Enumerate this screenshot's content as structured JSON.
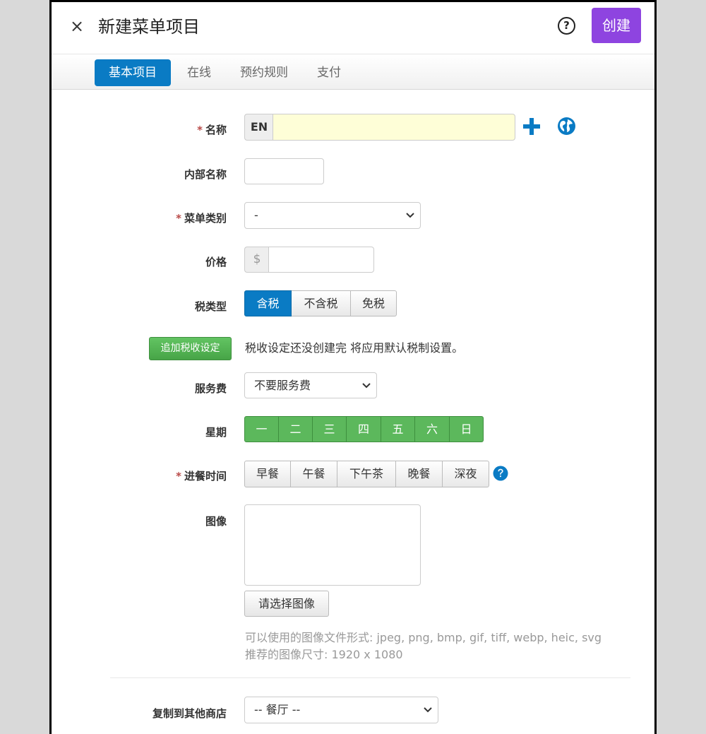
{
  "header": {
    "close_glyph": "×",
    "title": "新建菜单项目",
    "help_glyph": "?",
    "create_label": "创建"
  },
  "tabs": [
    {
      "label": "基本项目",
      "active": true
    },
    {
      "label": "在线",
      "active": false
    },
    {
      "label": "预约规则",
      "active": false
    },
    {
      "label": "支付",
      "active": false
    }
  ],
  "form": {
    "name": {
      "required": "*",
      "label": "名称",
      "lang_addon": "EN",
      "value": ""
    },
    "internal_name": {
      "label": "内部名称",
      "value": ""
    },
    "category": {
      "required": "*",
      "label": "菜单类别",
      "selected": "-"
    },
    "price": {
      "label": "价格",
      "currency": "$",
      "value": ""
    },
    "tax_type": {
      "label": "税类型",
      "options": [
        "含税",
        "不含税",
        "免税"
      ],
      "selected": "含税"
    },
    "tax_setting": {
      "button_label": "追加税收设定",
      "notice": "税收设定还没创建完 将应用默认税制设置。"
    },
    "service_fee": {
      "label": "服务费",
      "selected": "不要服务费"
    },
    "weekdays": {
      "label": "星期",
      "days": [
        "一",
        "二",
        "三",
        "四",
        "五",
        "六",
        "日"
      ]
    },
    "meal_time": {
      "required": "*",
      "label": "进餐时间",
      "options": [
        "早餐",
        "午餐",
        "下午茶",
        "晚餐",
        "深夜"
      ]
    },
    "image": {
      "label": "图像",
      "choose_label": "请选择图像",
      "formats_hint": "可以使用的图像文件形式: jpeg, png, bmp, gif, tiff, webp, heic, svg",
      "size_hint": "推荐的图像尺寸: 1920 x 1080"
    },
    "copy_to_store": {
      "label": "复制到其他商店",
      "selected": "-- 餐厅 --"
    }
  },
  "colors": {
    "create_button": "#8e44e0",
    "primary_blue": "#0a7bc4",
    "day_green": "#5cb85c",
    "required_asterisk": "#b94a48",
    "input_highlight": "#fefed7"
  },
  "icons": {
    "add": "plus-icon",
    "translate": "globe-icon",
    "meal_help": "question-circle-icon",
    "dropdown": "chevron-down-icon"
  }
}
